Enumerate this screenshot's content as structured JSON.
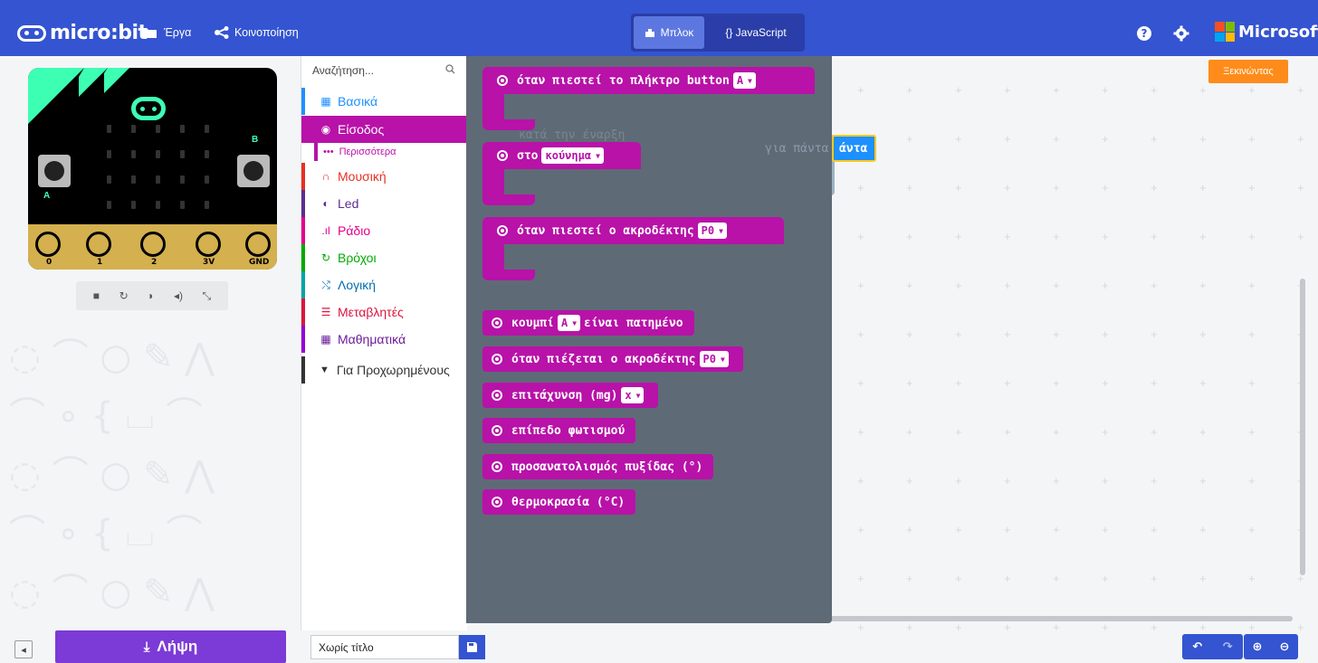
{
  "header": {
    "brand": "micro:bit",
    "projects": "Έργα",
    "share": "Κοινοποίηση",
    "tab_blocks": "Μπλοκ",
    "tab_js": "{} JavaScript",
    "microsoft": "Microsoft"
  },
  "simulator": {
    "pin_labels": [
      "0",
      "1",
      "2",
      "3V",
      "GND"
    ],
    "button_a": "A",
    "button_b": "B"
  },
  "toolbox": {
    "search_placeholder": "Αναζήτηση...",
    "categories": [
      {
        "label": "Βασικά",
        "color": "#1e90ff",
        "icon": "grid-icon"
      },
      {
        "label": "Είσοδος",
        "color": "#b812a8",
        "icon": "radio-circle-icon"
      },
      {
        "label": "Μουσική",
        "color": "#e63022",
        "icon": "headphones-icon"
      },
      {
        "label": "Led",
        "color": "#5c2d91",
        "icon": "toggle-icon"
      },
      {
        "label": "Ράδιο",
        "color": "#e3008c",
        "icon": "signal-bars-icon"
      },
      {
        "label": "Βρόχοι",
        "color": "#00aa00",
        "icon": "refresh-icon"
      },
      {
        "label": "Λογική",
        "color": "#00a4a6",
        "icon": "shuffle-icon"
      },
      {
        "label": "Μεταβλητές",
        "color": "#dc143c",
        "icon": "list-lines-icon"
      },
      {
        "label": "Μαθηματικά",
        "color": "#9400d3",
        "icon": "calculator-icon"
      }
    ],
    "more": "Περισσότερα",
    "advanced": "Για Προχωρημένους"
  },
  "flyout": {
    "button_press": "όταν πιεστεί το πλήκτρο button",
    "button_press_dd": "A",
    "gesture": "στο",
    "gesture_dd": "κούνημα",
    "pin_press": "όταν πιεστεί ο ακροδέκτης",
    "pin_press_dd": "P0",
    "button_is": "κουμπί",
    "button_is_dd": "A",
    "button_is_tail": "είναι πατημένο",
    "pin_is": "όταν πιέζεται ο ακροδέκτης",
    "pin_is_dd": "P0",
    "accel": "επιτάχυνση (mg)",
    "accel_dd": "x",
    "light": "επίπεδο φωτισμού",
    "compass": "προσανατολισμός πυξίδας (°)",
    "temp": "θερμοκρασία (°C)",
    "ghost_start": "κατά την έναρξη",
    "ghost_forever": "για πάντα"
  },
  "workspace": {
    "forever_label": "άντα",
    "start_button": "Ξεκινώντας"
  },
  "footer": {
    "download": "Λήψη",
    "project_name": "Χωρίς τίτλο"
  }
}
